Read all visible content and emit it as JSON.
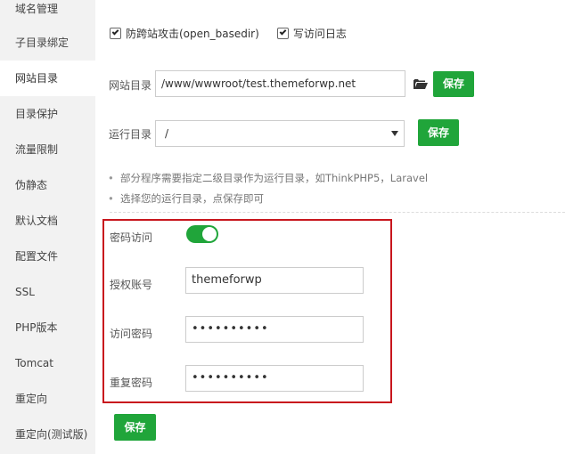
{
  "sidebar": {
    "items": [
      {
        "label": "域名管理"
      },
      {
        "label": "子目录绑定"
      },
      {
        "label": "网站目录"
      },
      {
        "label": "目录保护"
      },
      {
        "label": "流量限制"
      },
      {
        "label": "伪静态"
      },
      {
        "label": "默认文档"
      },
      {
        "label": "配置文件"
      },
      {
        "label": "SSL"
      },
      {
        "label": "PHP版本"
      },
      {
        "label": "Tomcat"
      },
      {
        "label": "重定向"
      },
      {
        "label": "重定向(测试版)"
      }
    ],
    "active_index": 2
  },
  "options": {
    "anti_xss_label": "防跨站攻击(open_basedir)",
    "anti_xss_checked": true,
    "access_log_label": "写访问日志",
    "access_log_checked": true
  },
  "site_dir": {
    "label": "网站目录",
    "value": "/www/wwwroot/test.themeforwp.net",
    "folder_icon": "folder-icon",
    "save_label": "保存"
  },
  "run_dir": {
    "label": "运行目录",
    "selected": "/",
    "save_label": "保存"
  },
  "notes": [
    "部分程序需要指定二级目录作为运行目录，如ThinkPHP5，Laravel",
    "选择您的运行目录，点保存即可"
  ],
  "password_access": {
    "label": "密码访问",
    "enabled": true,
    "account_label": "授权账号",
    "account_value": "themeforwp",
    "password_label": "访问密码",
    "password_value": "••••••••••",
    "repeat_label": "重复密码",
    "repeat_value": "••••••••••"
  },
  "save_button_label": "保存",
  "colors": {
    "accent_green": "#20a53a",
    "highlight_red": "#c8161d",
    "sidebar_bg": "#f2f2f2"
  }
}
